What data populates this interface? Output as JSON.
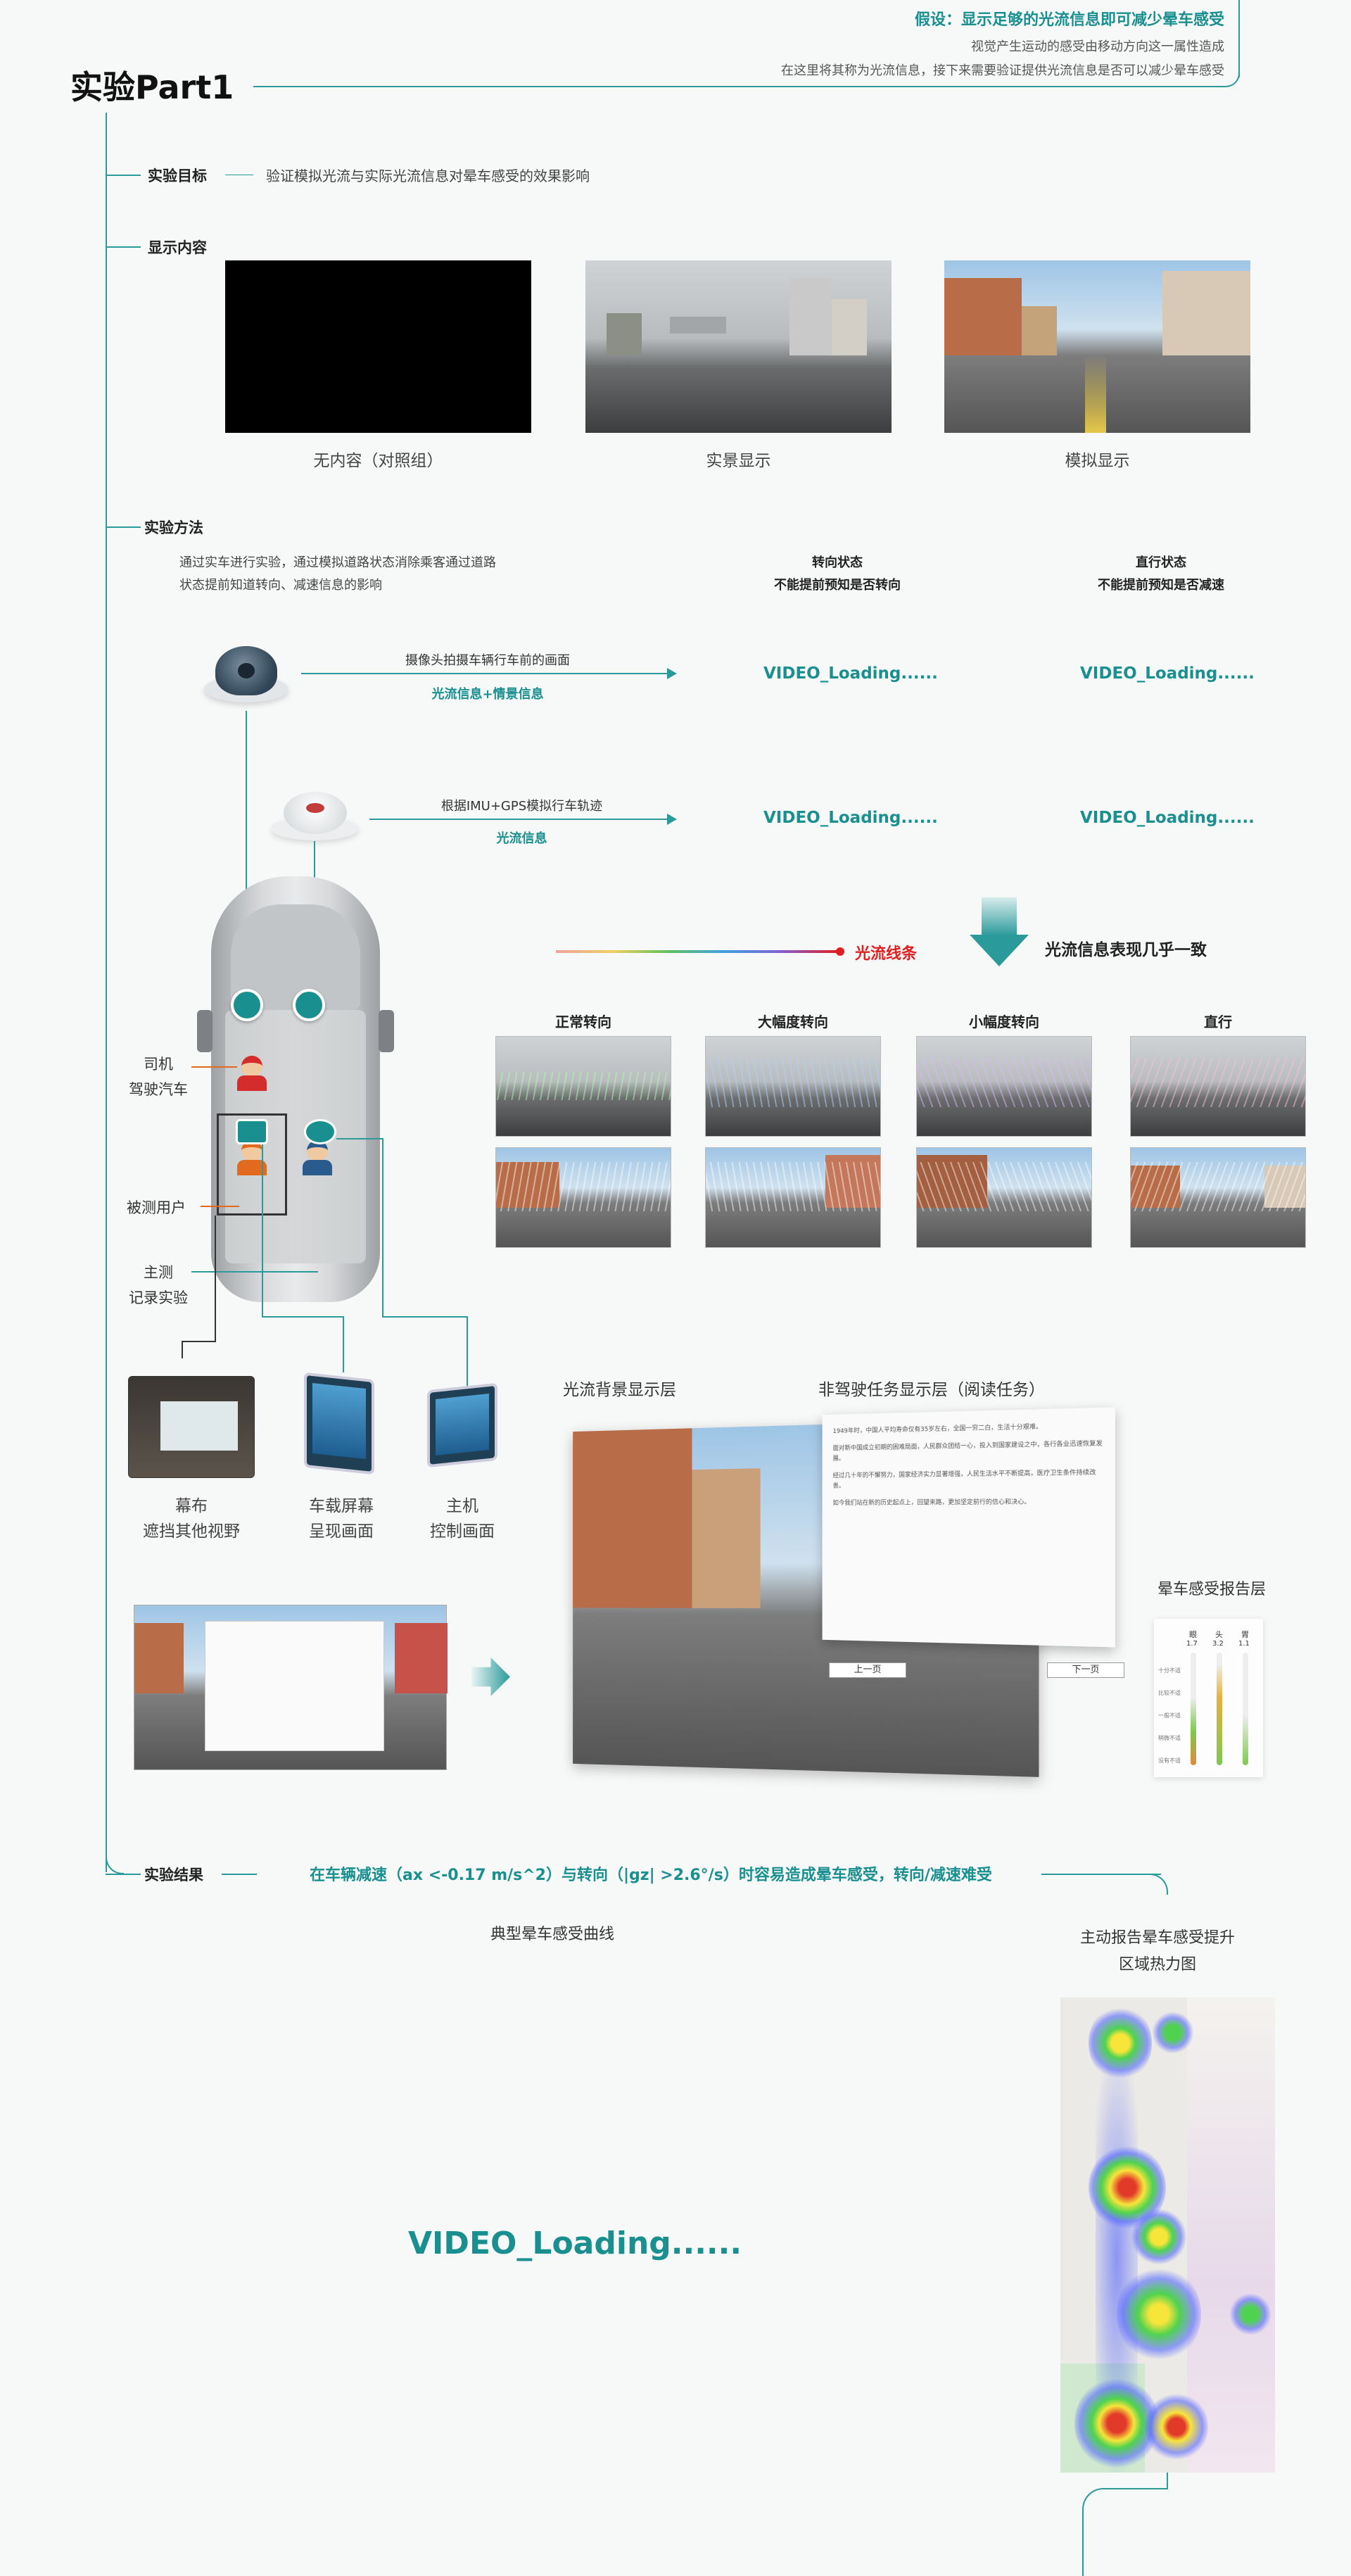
{
  "hypothesis": {
    "title": "假设：显示足够的光流信息即可减少晕车感受",
    "line1": "视觉产生运动的感受由移动方向这一属性造成",
    "line2": "在这里将其称为光流信息，接下来需要验证提供光流信息是否可以减少晕车感受"
  },
  "page_title": "实验Part1",
  "goal": {
    "label": "实验目标",
    "text": "验证模拟光流与实际光流信息对晕车感受的效果影响"
  },
  "display": {
    "label": "显示内容",
    "items": [
      "无内容（对照组）",
      "实景显示",
      "模拟显示"
    ]
  },
  "method": {
    "label": "实验方法",
    "desc1": "通过实车进行实验，通过模拟道路状态消除乘客通过道路",
    "desc2": "状态提前知道转向、减速信息的影响",
    "col1_title": "转向状态",
    "col1_sub": "不能提前预知是否转向",
    "col2_title": "直行状态",
    "col2_sub": "不能提前预知是否减速",
    "row1_text": "摄像头拍摄车辆行车前的画面",
    "row1_tag": "光流信息+情景信息",
    "row2_text": "根据IMU+GPS模拟行车轨迹",
    "row2_tag": "光流信息",
    "video_loading": "VIDEO_Loading......",
    "optflow_line": "光流线条",
    "optflow_conclusion": "光流信息表现几乎一致",
    "turn_types": [
      "正常转向",
      "大幅度转向",
      "小幅度转向",
      "直行"
    ],
    "driver_label1": "司机",
    "driver_label2": "驾驶汽车",
    "user_label": "被测用户",
    "observer_label1": "主测",
    "observer_label2": "记录实验"
  },
  "devices": [
    {
      "l1": "幕布",
      "l2": "遮挡其他视野"
    },
    {
      "l1": "车载屏幕",
      "l2": "呈现画面"
    },
    {
      "l1": "主机",
      "l2": "控制画面"
    }
  ],
  "layers": {
    "bg": "光流背景显示层",
    "task": "非驾驶任务显示层（阅读任务）",
    "report": "晕车感受报告层",
    "prev": "上一页",
    "next": "下一页",
    "meter_labels": [
      "眼",
      "头",
      "胃"
    ],
    "meter_values": [
      "1.7",
      "3.2",
      "1.1"
    ],
    "scale": [
      "十分不适",
      "比较不适",
      "一般不适",
      "稍微不适",
      "没有不适"
    ]
  },
  "reading": {
    "p1": "1949年时，中国人平均寿命仅有35岁左右，全国一穷二白，生活十分艰难。",
    "p2": "面对新中国成立初期的困难局面，人民群众团结一心，投入到国家建设之中，各行各业迅速恢复发展。",
    "p3": "经过几十年的不懈努力，国家经济实力显著增强，人民生活水平不断提高，医疗卫生条件持续改善。",
    "p4": "如今我们站在新的历史起点上，回望来路，更加坚定前行的信心和决心。"
  },
  "result": {
    "label": "实验结果",
    "text": "在车辆减速（ax <-0.17 m/s^2）与转向（|gz| >2.6°/s）时容易造成晕车感受，转向/减速难受",
    "curve_title": "典型晕车感受曲线",
    "heat_title1": "主动报告晕车感受提升",
    "heat_title2": "区域热力图",
    "video": "VIDEO_Loading......"
  },
  "colors": {
    "accent": "#1a8f8f",
    "red": "#e02020"
  }
}
